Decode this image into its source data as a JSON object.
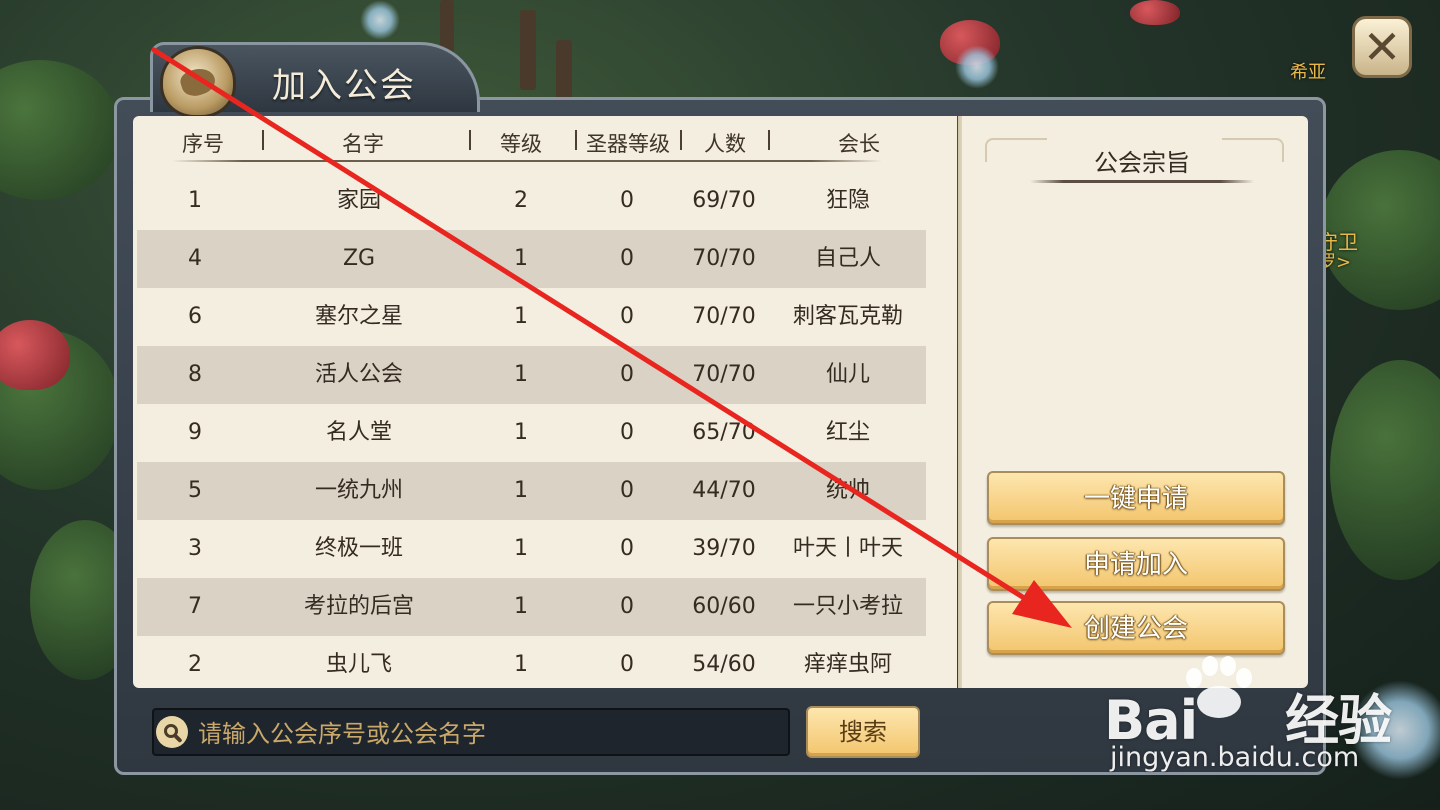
{
  "window": {
    "title": "加入公会",
    "close_icon": "close-icon",
    "emblem_icon": "guild-emblem-icon"
  },
  "background": {
    "npc_labels": [
      "希亚",
      "守卫",
      "罗>"
    ]
  },
  "table": {
    "headers": [
      "序号",
      "名字",
      "等级",
      "圣器等级",
      "人数",
      "会长"
    ],
    "rows": [
      {
        "no": "1",
        "name": "家园",
        "level": "2",
        "artifact": "0",
        "members": "69/70",
        "leader": "狂隐"
      },
      {
        "no": "4",
        "name": "ZG",
        "level": "1",
        "artifact": "0",
        "members": "70/70",
        "leader": "自己人"
      },
      {
        "no": "6",
        "name": "塞尔之星",
        "level": "1",
        "artifact": "0",
        "members": "70/70",
        "leader": "刺客瓦克勒"
      },
      {
        "no": "8",
        "name": "活人公会",
        "level": "1",
        "artifact": "0",
        "members": "70/70",
        "leader": "仙儿"
      },
      {
        "no": "9",
        "name": "名人堂",
        "level": "1",
        "artifact": "0",
        "members": "65/70",
        "leader": "红尘"
      },
      {
        "no": "5",
        "name": "一统九州",
        "level": "1",
        "artifact": "0",
        "members": "44/70",
        "leader": "统帅"
      },
      {
        "no": "3",
        "name": "终极一班",
        "level": "1",
        "artifact": "0",
        "members": "39/70",
        "leader": "叶天丨叶天"
      },
      {
        "no": "7",
        "name": "考拉的后宫",
        "level": "1",
        "artifact": "0",
        "members": "60/60",
        "leader": "一只小考拉"
      },
      {
        "no": "2",
        "name": "虫儿飞",
        "level": "1",
        "artifact": "0",
        "members": "54/60",
        "leader": "痒痒虫阿"
      }
    ]
  },
  "side": {
    "purpose_title": "公会宗旨",
    "buttons": {
      "quick_apply": "一键申请",
      "apply_join": "申请加入",
      "create_guild": "创建公会"
    }
  },
  "search": {
    "placeholder": "请输入公会序号或公会名字",
    "button": "搜索",
    "icon": "search-icon"
  },
  "watermark": {
    "brand": "Bai",
    "brand_tail": "经验",
    "url": "jingyan.baidu.com"
  },
  "colors": {
    "panel_bg": "#f4eee0",
    "row_alt": "#d9d2c5",
    "button_gold": "#f3c56d",
    "frame": "#434d58",
    "annotation_arrow": "#e8261f"
  }
}
